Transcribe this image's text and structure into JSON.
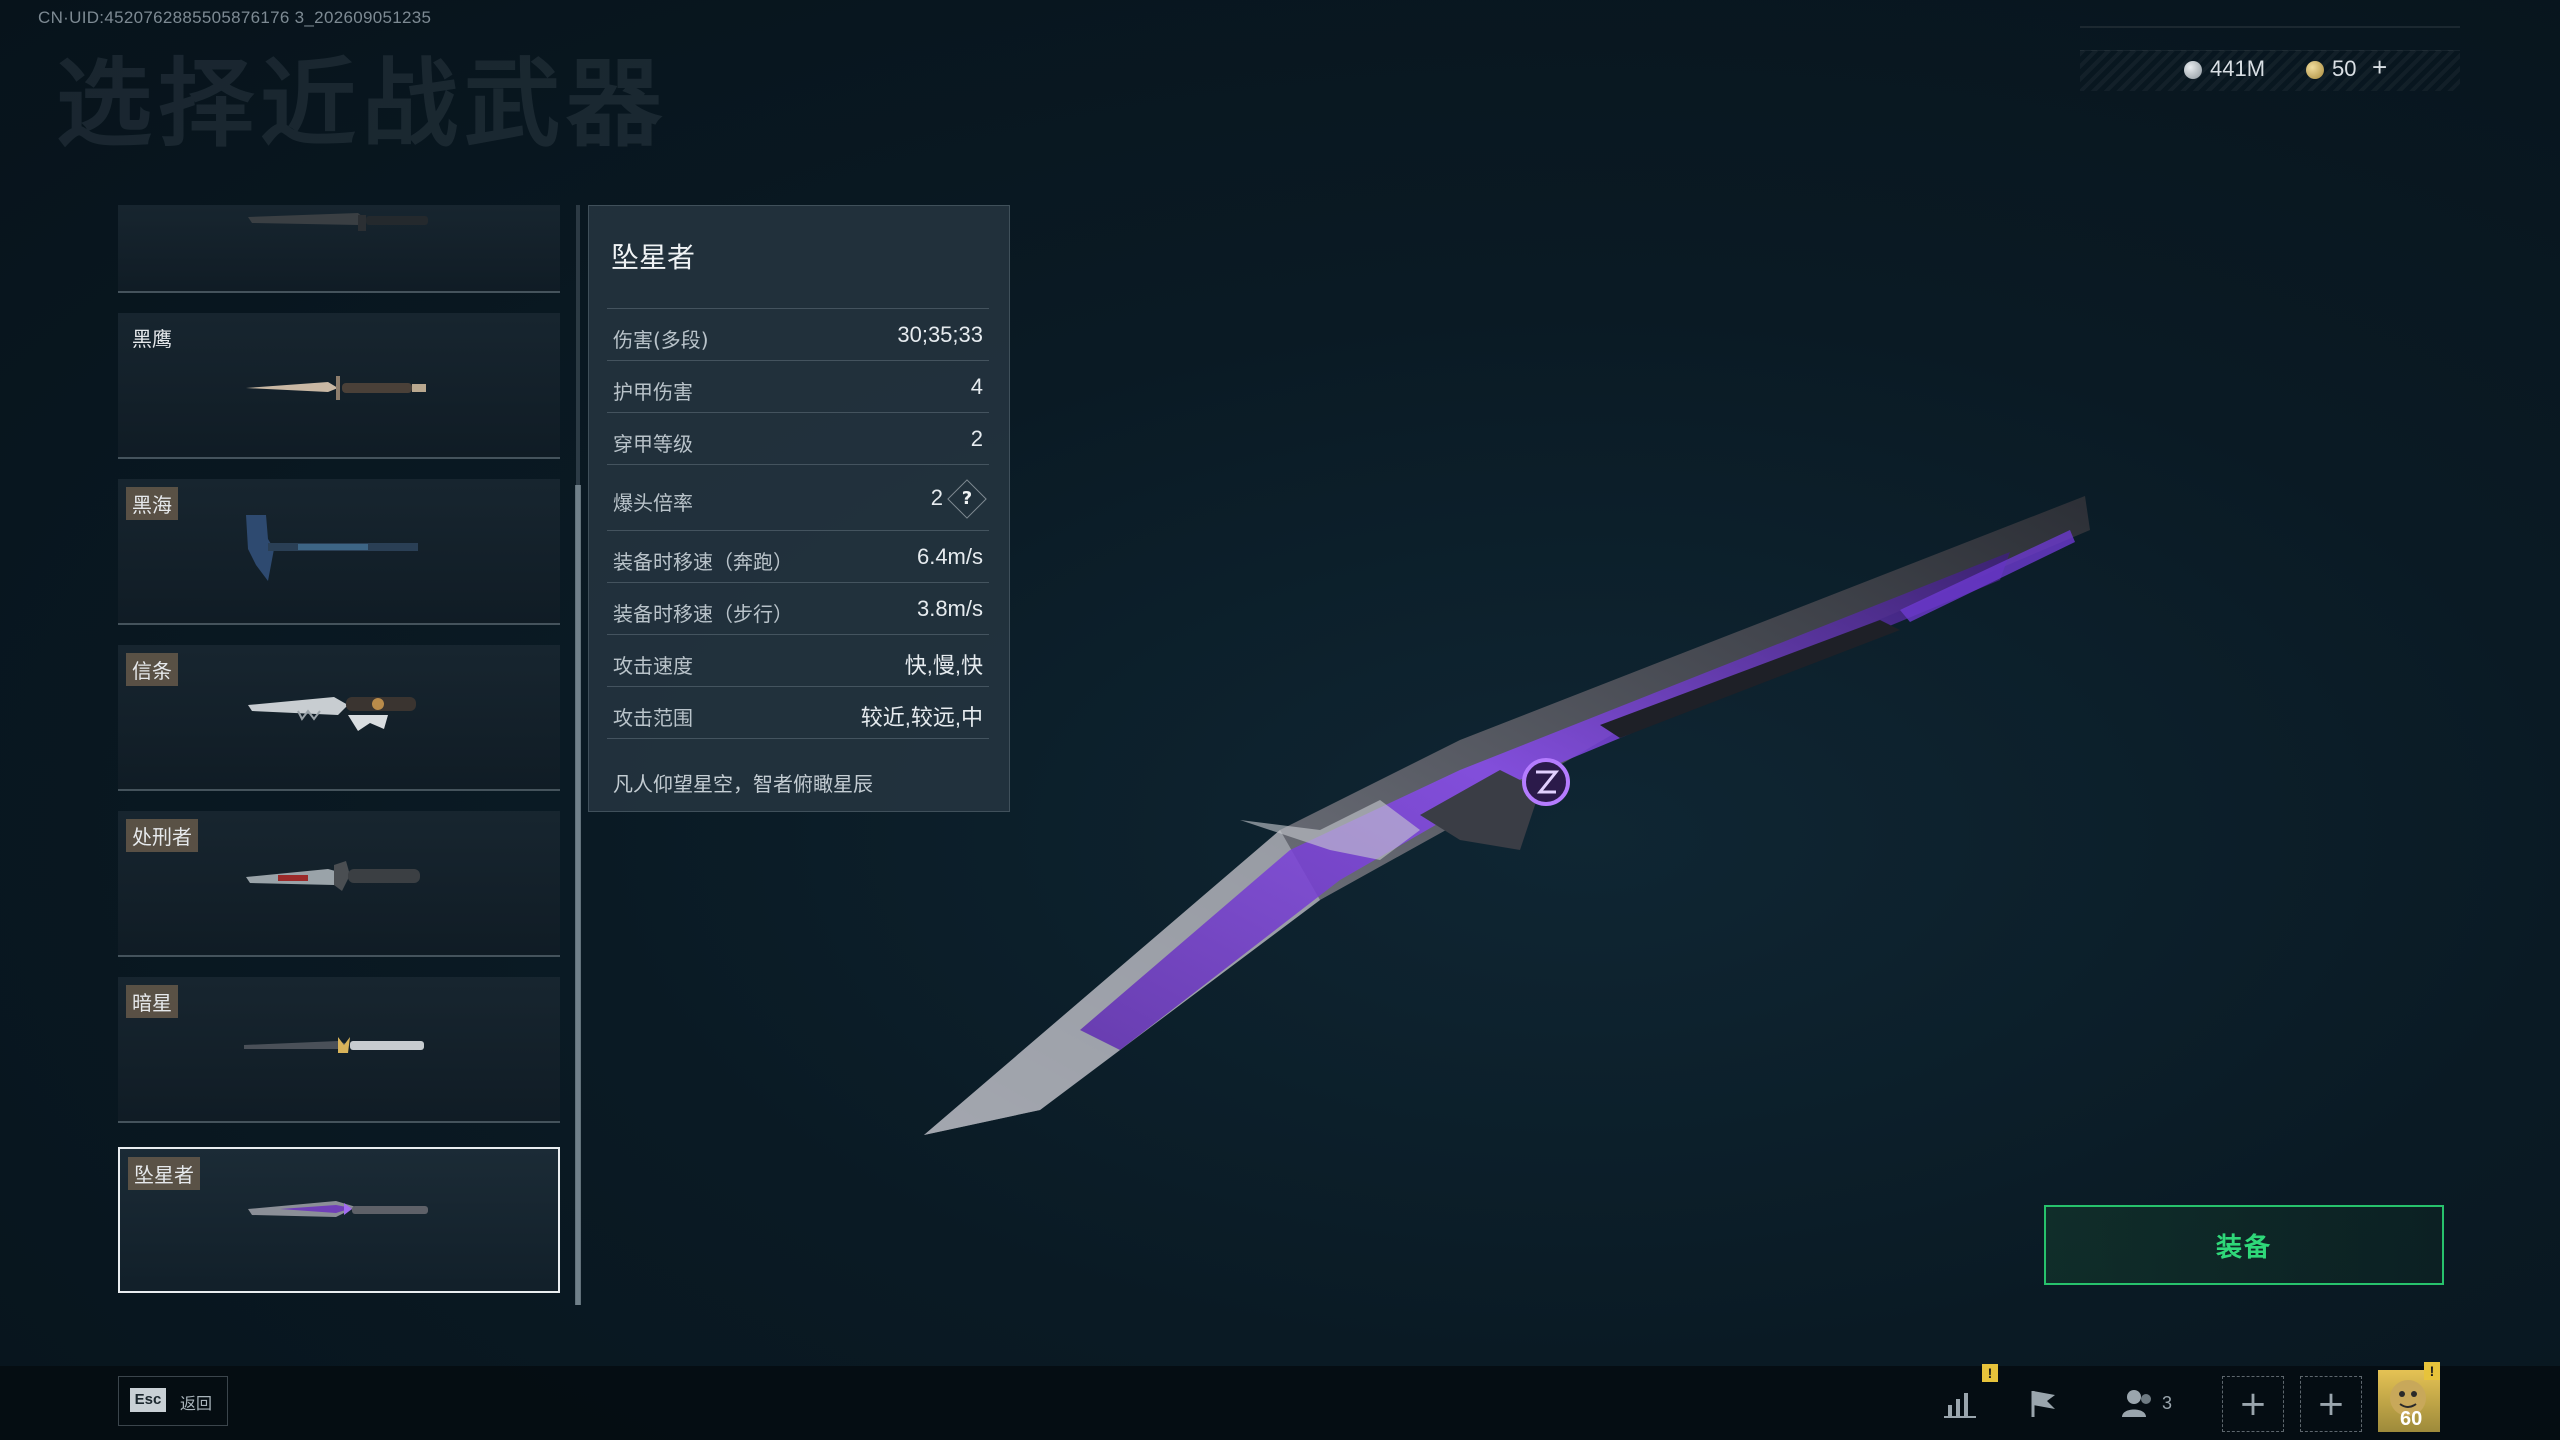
{
  "header": {
    "uid": "CN·UID:4520762885505876176 3_202609051235",
    "title": "选择近战武器"
  },
  "currency": [
    {
      "icon": "silver-coin-icon",
      "value": "441M"
    },
    {
      "icon": "gold-coin-icon",
      "value": "50",
      "add": "+"
    }
  ],
  "weapon_list": [
    {
      "tag": "",
      "icon": "combat-knife-icon"
    },
    {
      "tag": "黑鹰",
      "icon": "bayonet-knife-icon"
    },
    {
      "tag": "黑海",
      "icon": "tomahawk-axe-icon"
    },
    {
      "tag": "信条",
      "icon": "serrated-knife-icon"
    },
    {
      "tag": "处刑者",
      "icon": "executioner-knife-icon"
    },
    {
      "tag": "暗星",
      "icon": "dark-star-knife-icon"
    },
    {
      "tag": "坠星者",
      "icon": "starfall-knife-icon",
      "selected": true
    }
  ],
  "stats": {
    "name": "坠星者",
    "rows": [
      {
        "label": "伤害(多段)",
        "value": "30;35;33"
      },
      {
        "label": "护甲伤害",
        "value": "4"
      },
      {
        "label": "穿甲等级",
        "value": "2"
      },
      {
        "label": "爆头倍率",
        "value": "2",
        "help": "?"
      },
      {
        "label": "装备时移速（奔跑）",
        "value": "6.4m/s"
      },
      {
        "label": "装备时移速（步行）",
        "value": "3.8m/s"
      },
      {
        "label": "攻击速度",
        "value": "快,慢,快"
      },
      {
        "label": "攻击范围",
        "value": "较近,较远,中"
      }
    ],
    "flavor": "凡人仰望星空，智者俯瞰星辰"
  },
  "equip": {
    "label": "装备"
  },
  "bottom": {
    "esc_key": "Esc",
    "esc_label": "返回",
    "squad_count": "3",
    "plus_1": "+",
    "plus_2": "+",
    "alert_1": "!",
    "alert_2": "!",
    "level": "60"
  },
  "colors": {
    "accent_green": "#2fd879",
    "tag_bg": "#70604e",
    "alert": "#e7c33b"
  }
}
